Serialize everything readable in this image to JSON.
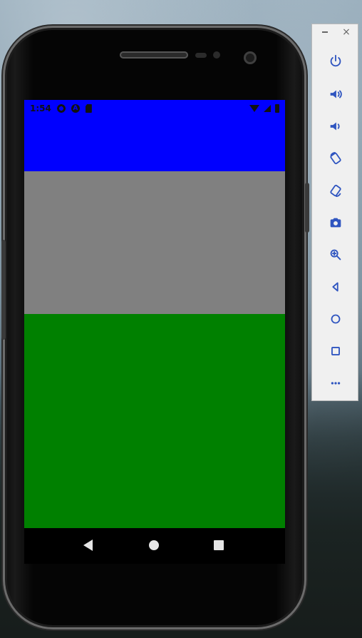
{
  "colors": {
    "panel_top": "#0000ff",
    "panel_middle": "#808080",
    "panel_bottom": "#008000",
    "toolbar_icon": "#2f55c0"
  },
  "device": {
    "status_bar": {
      "time": "1:54",
      "left_icons": [
        "gear-icon",
        "a-icon",
        "sd-card-icon"
      ],
      "right_icons": [
        "wifi-icon",
        "signal-icon",
        "battery-icon"
      ]
    },
    "nav_bar": {
      "buttons": [
        "back",
        "home",
        "recents"
      ]
    }
  },
  "emulator_toolbar": {
    "window_controls": {
      "minimize": "−",
      "close": "×"
    },
    "buttons": [
      {
        "name": "power-icon"
      },
      {
        "name": "volume-up-icon"
      },
      {
        "name": "volume-down-icon"
      },
      {
        "name": "rotate-left-icon"
      },
      {
        "name": "rotate-right-icon"
      },
      {
        "name": "camera-icon"
      },
      {
        "name": "zoom-icon"
      },
      {
        "name": "back-icon"
      },
      {
        "name": "home-icon"
      },
      {
        "name": "overview-icon"
      },
      {
        "name": "more-icon"
      }
    ]
  }
}
